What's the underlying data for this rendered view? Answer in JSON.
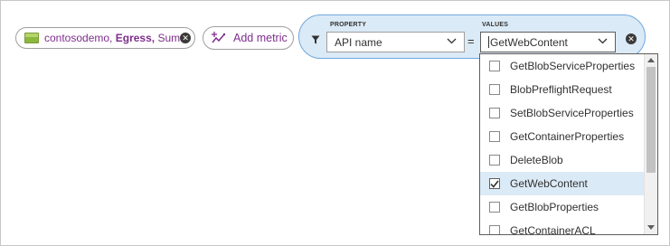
{
  "metric": {
    "resource": "contosodemo,",
    "metric_name": "Egress,",
    "aggregation": "Sum",
    "close_glyph": "✕"
  },
  "add_metric": {
    "label": "Add metric"
  },
  "filter": {
    "property_label": "PROPERTY",
    "property_value": "API name",
    "operator": "=",
    "values_label": "VALUES",
    "values_value": "GetWebContent",
    "close_glyph": "✕"
  },
  "dropdown": {
    "items": [
      {
        "label": "GetBlobServiceProperties",
        "checked": false
      },
      {
        "label": "BlobPreflightRequest",
        "checked": false
      },
      {
        "label": "SetBlobServiceProperties",
        "checked": false
      },
      {
        "label": "GetContainerProperties",
        "checked": false
      },
      {
        "label": "DeleteBlob",
        "checked": false
      },
      {
        "label": "GetWebContent",
        "checked": true
      },
      {
        "label": "GetBlobProperties",
        "checked": false
      },
      {
        "label": "GetContainerACL",
        "checked": false
      }
    ]
  },
  "colors": {
    "accent_purple": "#7e2e8c",
    "filter_bg": "#dbeaf7",
    "filter_border": "#6fa8dc",
    "selected_row": "#dbeaf7"
  }
}
